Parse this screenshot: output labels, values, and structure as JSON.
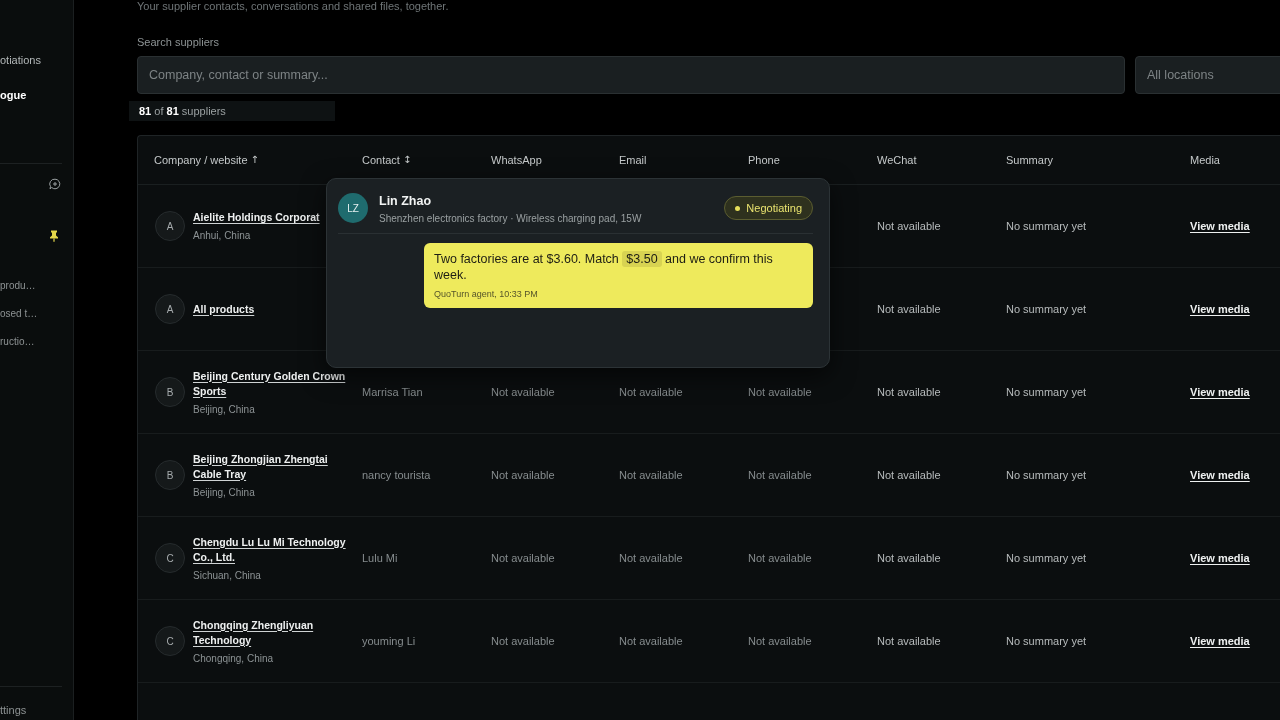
{
  "sidebar": {
    "nav": [
      {
        "label": "otiations",
        "selected": false
      },
      {
        "label": "ogue",
        "selected": true
      }
    ],
    "conversations": [
      "produ…",
      "osed t…",
      "ructio…"
    ],
    "footer": "ttings"
  },
  "page": {
    "subtitle": "Your supplier contacts, conversations and shared files, together."
  },
  "search": {
    "label": "Search suppliers",
    "placeholder": "Company, contact or summary...",
    "location": "All locations"
  },
  "count": "**81** of **81** suppliers",
  "table": {
    "columns": [
      {
        "label": "Company / website",
        "sort_mark": "↑"
      },
      {
        "label": "Contact",
        "sort_mark": "↕"
      },
      {
        "label": "WhatsApp"
      },
      {
        "label": "Email"
      },
      {
        "label": "Phone"
      },
      {
        "label": "WeChat"
      },
      {
        "label": "Summary"
      },
      {
        "label": "Media"
      }
    ],
    "rows": [
      {
        "initial": "A",
        "company": "Aielite Holdings Corporat",
        "location": "Anhui, China",
        "wechat": "Not available",
        "summary": "No summary yet",
        "media": "View media"
      },
      {
        "initial": "A",
        "company": "All products",
        "wechat": "Not available",
        "summary": "No summary yet",
        "media": "View media"
      },
      {
        "initial": "B",
        "company": "Beijing Century Golden Crown Sports",
        "location": "Beijing, China",
        "contact": "Marrisa Tian",
        "whatsapp": "Not available",
        "email": "Not available",
        "phone": "Not available",
        "wechat": "Not available",
        "summary": "No summary yet",
        "media": "View media"
      },
      {
        "initial": "B",
        "company": "Beijing Zhongjian Zhengtai Cable Tray",
        "location": "Beijing, China",
        "contact": "nancy tourista",
        "whatsapp": "Not available",
        "email": "Not available",
        "phone": "Not available",
        "wechat": "Not available",
        "summary": "No summary yet",
        "media": "View media"
      },
      {
        "initial": "C",
        "company": "Chengdu Lu Lu Mi Technology Co., Ltd.",
        "location": "Sichuan, China",
        "contact": "Lulu Mi",
        "whatsapp": "Not available",
        "email": "Not available",
        "phone": "Not available",
        "wechat": "Not available",
        "summary": "No summary yet",
        "media": "View media"
      },
      {
        "initial": "C",
        "company": "Chongqing Zhengliyuan Technology",
        "location": "Chongqing, China",
        "contact": "youming Li",
        "whatsapp": "Not available",
        "email": "Not available",
        "phone": "Not available",
        "wechat": "Not available",
        "summary": "No summary yet",
        "media": "View media"
      }
    ]
  },
  "popup": {
    "avatar": "LZ",
    "name": "Lin Zhao",
    "subtitle": "Shenzhen electronics factory · Wireless charging pad, 15W",
    "status": "Negotiating",
    "message": {
      "parts": [
        {
          "text": "Two factories are at $3.60. Match ",
          "highlight": false
        },
        {
          "text": "$3.50",
          "highlight": true
        },
        {
          "text": " and we confirm this week.",
          "highlight": false
        }
      ],
      "meta": "QuoTurn agent, 10:33 PM"
    }
  }
}
